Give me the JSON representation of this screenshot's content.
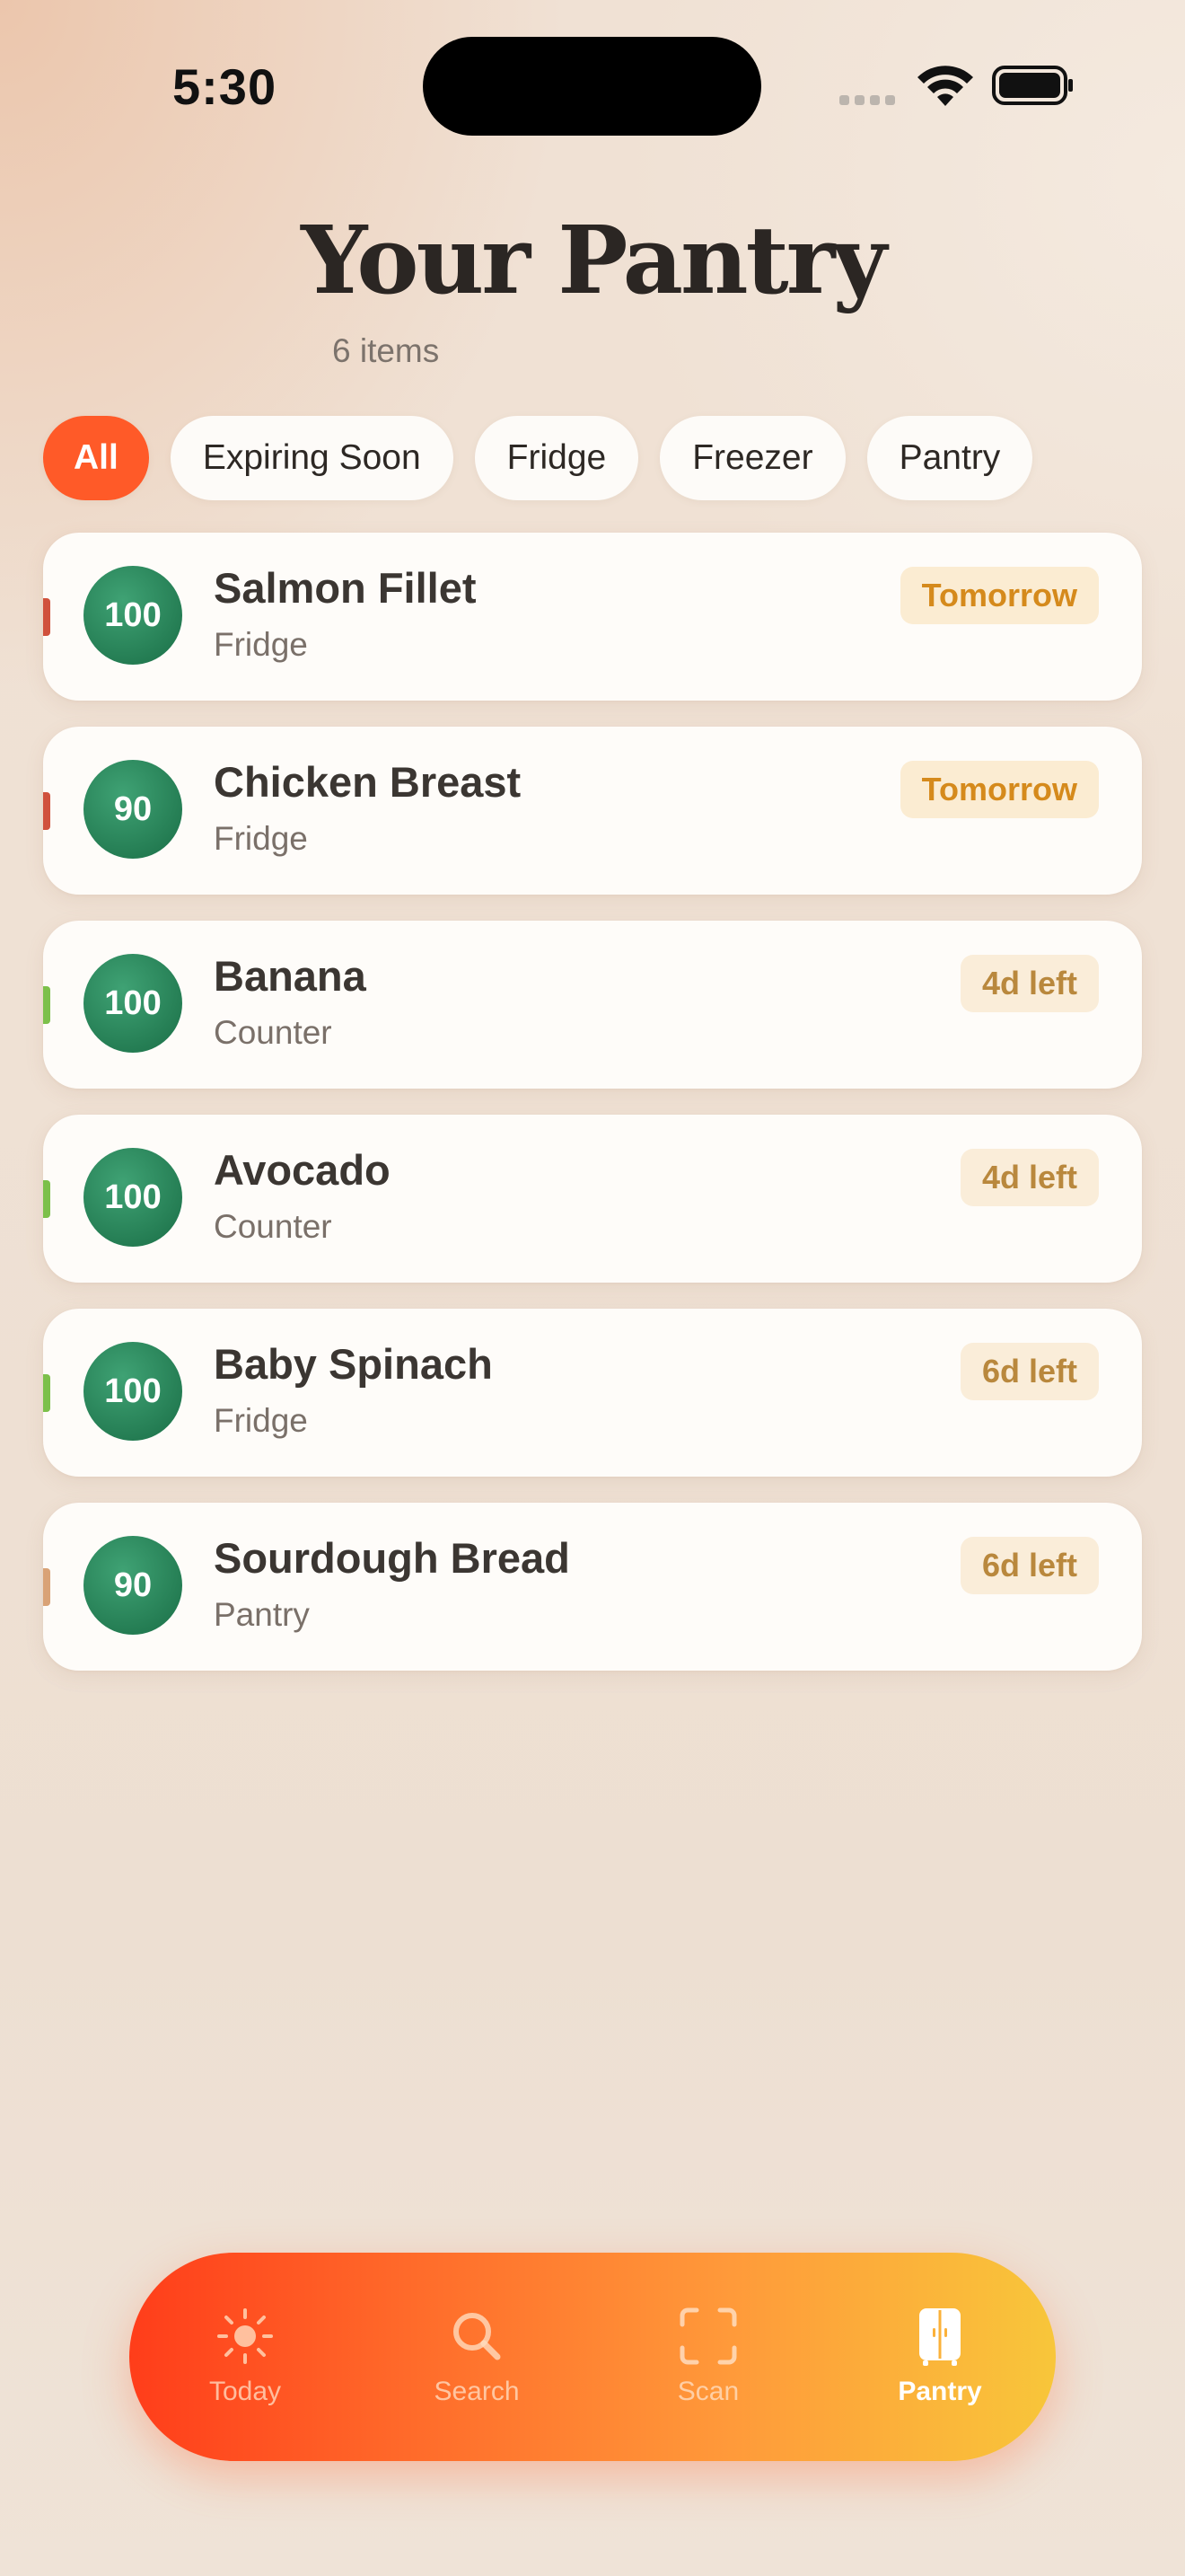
{
  "status_bar": {
    "time": "5:30"
  },
  "header": {
    "title": "Your Pantry",
    "item_count": "6 items"
  },
  "filters": [
    {
      "label": "All",
      "active": true
    },
    {
      "label": "Expiring Soon",
      "active": false
    },
    {
      "label": "Fridge",
      "active": false
    },
    {
      "label": "Freezer",
      "active": false
    },
    {
      "label": "Pantry",
      "active": false
    }
  ],
  "items": [
    {
      "score": "100",
      "name": "Salmon Fillet",
      "location": "Fridge",
      "badge": "Tomorrow",
      "bar_color": "#d0513c"
    },
    {
      "score": "90",
      "name": "Chicken Breast",
      "location": "Fridge",
      "badge": "Tomorrow",
      "bar_color": "#d0513c"
    },
    {
      "score": "100",
      "name": "Banana",
      "location": "Counter",
      "badge": "4d left",
      "bar_color": "#7cc04a"
    },
    {
      "score": "100",
      "name": "Avocado",
      "location": "Counter",
      "badge": "4d left",
      "bar_color": "#7cc04a"
    },
    {
      "score": "100",
      "name": "Baby Spinach",
      "location": "Fridge",
      "badge": "6d left",
      "bar_color": "#7cc04a"
    },
    {
      "score": "90",
      "name": "Sourdough Bread",
      "location": "Pantry",
      "badge": "6d left",
      "bar_color": "#d9a276"
    }
  ],
  "tabs": [
    {
      "label": "Today",
      "icon": "sun-icon",
      "active": false
    },
    {
      "label": "Search",
      "icon": "search-icon",
      "active": false
    },
    {
      "label": "Scan",
      "icon": "scan-icon",
      "active": false
    },
    {
      "label": "Pantry",
      "icon": "pantry-icon",
      "active": true
    }
  ],
  "colors": {
    "accent": "#ff5a28",
    "score_green": "#2a8a5c",
    "urgent_badge": "#d58a1c"
  }
}
